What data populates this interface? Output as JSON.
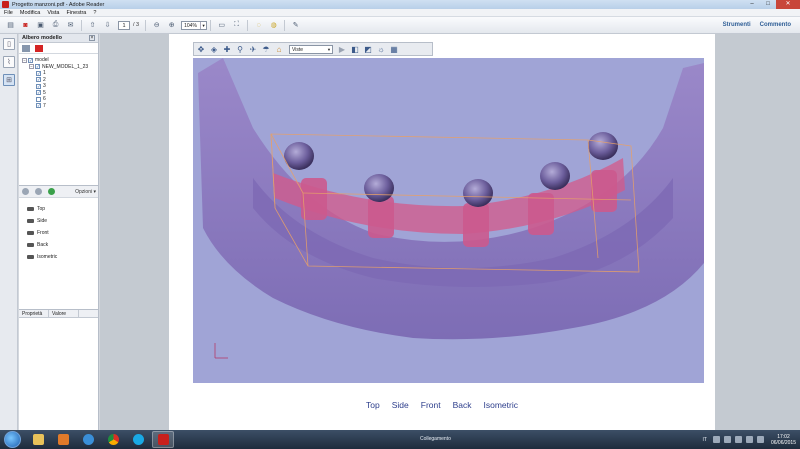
{
  "window": {
    "title": "Progetto manzoni.pdf - Adobe Reader",
    "controls": [
      "–",
      "□",
      "✕"
    ]
  },
  "menu": [
    "File",
    "Modifica",
    "Vista",
    "Finestra",
    "?"
  ],
  "toolbar": {
    "page_current": "1",
    "page_total": "/ 3",
    "zoom": "104%",
    "right_tools": "Strumenti",
    "right_comment": "Commento"
  },
  "model_panel": {
    "title": "Albero modello",
    "tree": [
      {
        "label": "model",
        "level": 0,
        "checked": true,
        "expander": "−"
      },
      {
        "label": "NEW_MODEL_1_23",
        "level": 1,
        "checked": true,
        "expander": "−"
      },
      {
        "label": "1",
        "level": 2,
        "checked": true,
        "expander": ""
      },
      {
        "label": "2",
        "level": 2,
        "checked": true,
        "expander": ""
      },
      {
        "label": "3",
        "level": 2,
        "checked": true,
        "expander": ""
      },
      {
        "label": "5",
        "level": 2,
        "checked": true,
        "expander": ""
      },
      {
        "label": "6",
        "level": 2,
        "checked": false,
        "expander": ""
      },
      {
        "label": "7",
        "level": 2,
        "checked": true,
        "expander": ""
      }
    ],
    "options_label": "Opzioni",
    "views": [
      "Top",
      "Side",
      "Front",
      "Back",
      "Isometric"
    ],
    "props_cols": [
      "Proprietà",
      "Valore"
    ]
  },
  "viewer": {
    "views_dropdown": "Viste",
    "nav_links": [
      "Top",
      "Side",
      "Front",
      "Back",
      "Isometric"
    ],
    "colors": {
      "background": "#a0a4d6",
      "gum": "#8f7bc4",
      "bar": "#d45a8a",
      "implant": "#6b5a9a",
      "bbox": "#e6a06a"
    }
  },
  "taskbar": {
    "center_text": "Collegamento",
    "lang": "IT",
    "time": "17:02",
    "date": "06/06/2015"
  }
}
